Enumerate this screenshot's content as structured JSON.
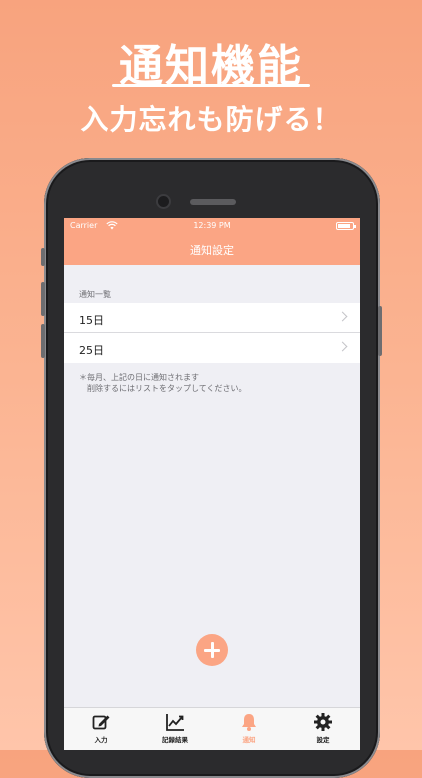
{
  "promo": {
    "title": "通知機能",
    "subtitle": "入力忘れも防げる！"
  },
  "status_bar": {
    "carrier": "Carrier",
    "time": "12:39 PM"
  },
  "navbar": {
    "title": "通知設定"
  },
  "list": {
    "section_header": "通知一覧",
    "rows": [
      {
        "label": "15日"
      },
      {
        "label": "25日"
      }
    ]
  },
  "footnote": {
    "line1": "＊毎月、上記の日に通知されます",
    "line2": "削除するにはリストをタップしてください。"
  },
  "tabbar": {
    "tabs": [
      {
        "label": "入力",
        "icon": "compose-icon"
      },
      {
        "label": "記録結果",
        "icon": "chart-line-icon"
      },
      {
        "label": "通知",
        "icon": "bell-icon",
        "active": true
      },
      {
        "label": "設定",
        "icon": "gear-icon"
      }
    ]
  },
  "colors": {
    "accent": "#fba584",
    "background": "#efeff4"
  }
}
